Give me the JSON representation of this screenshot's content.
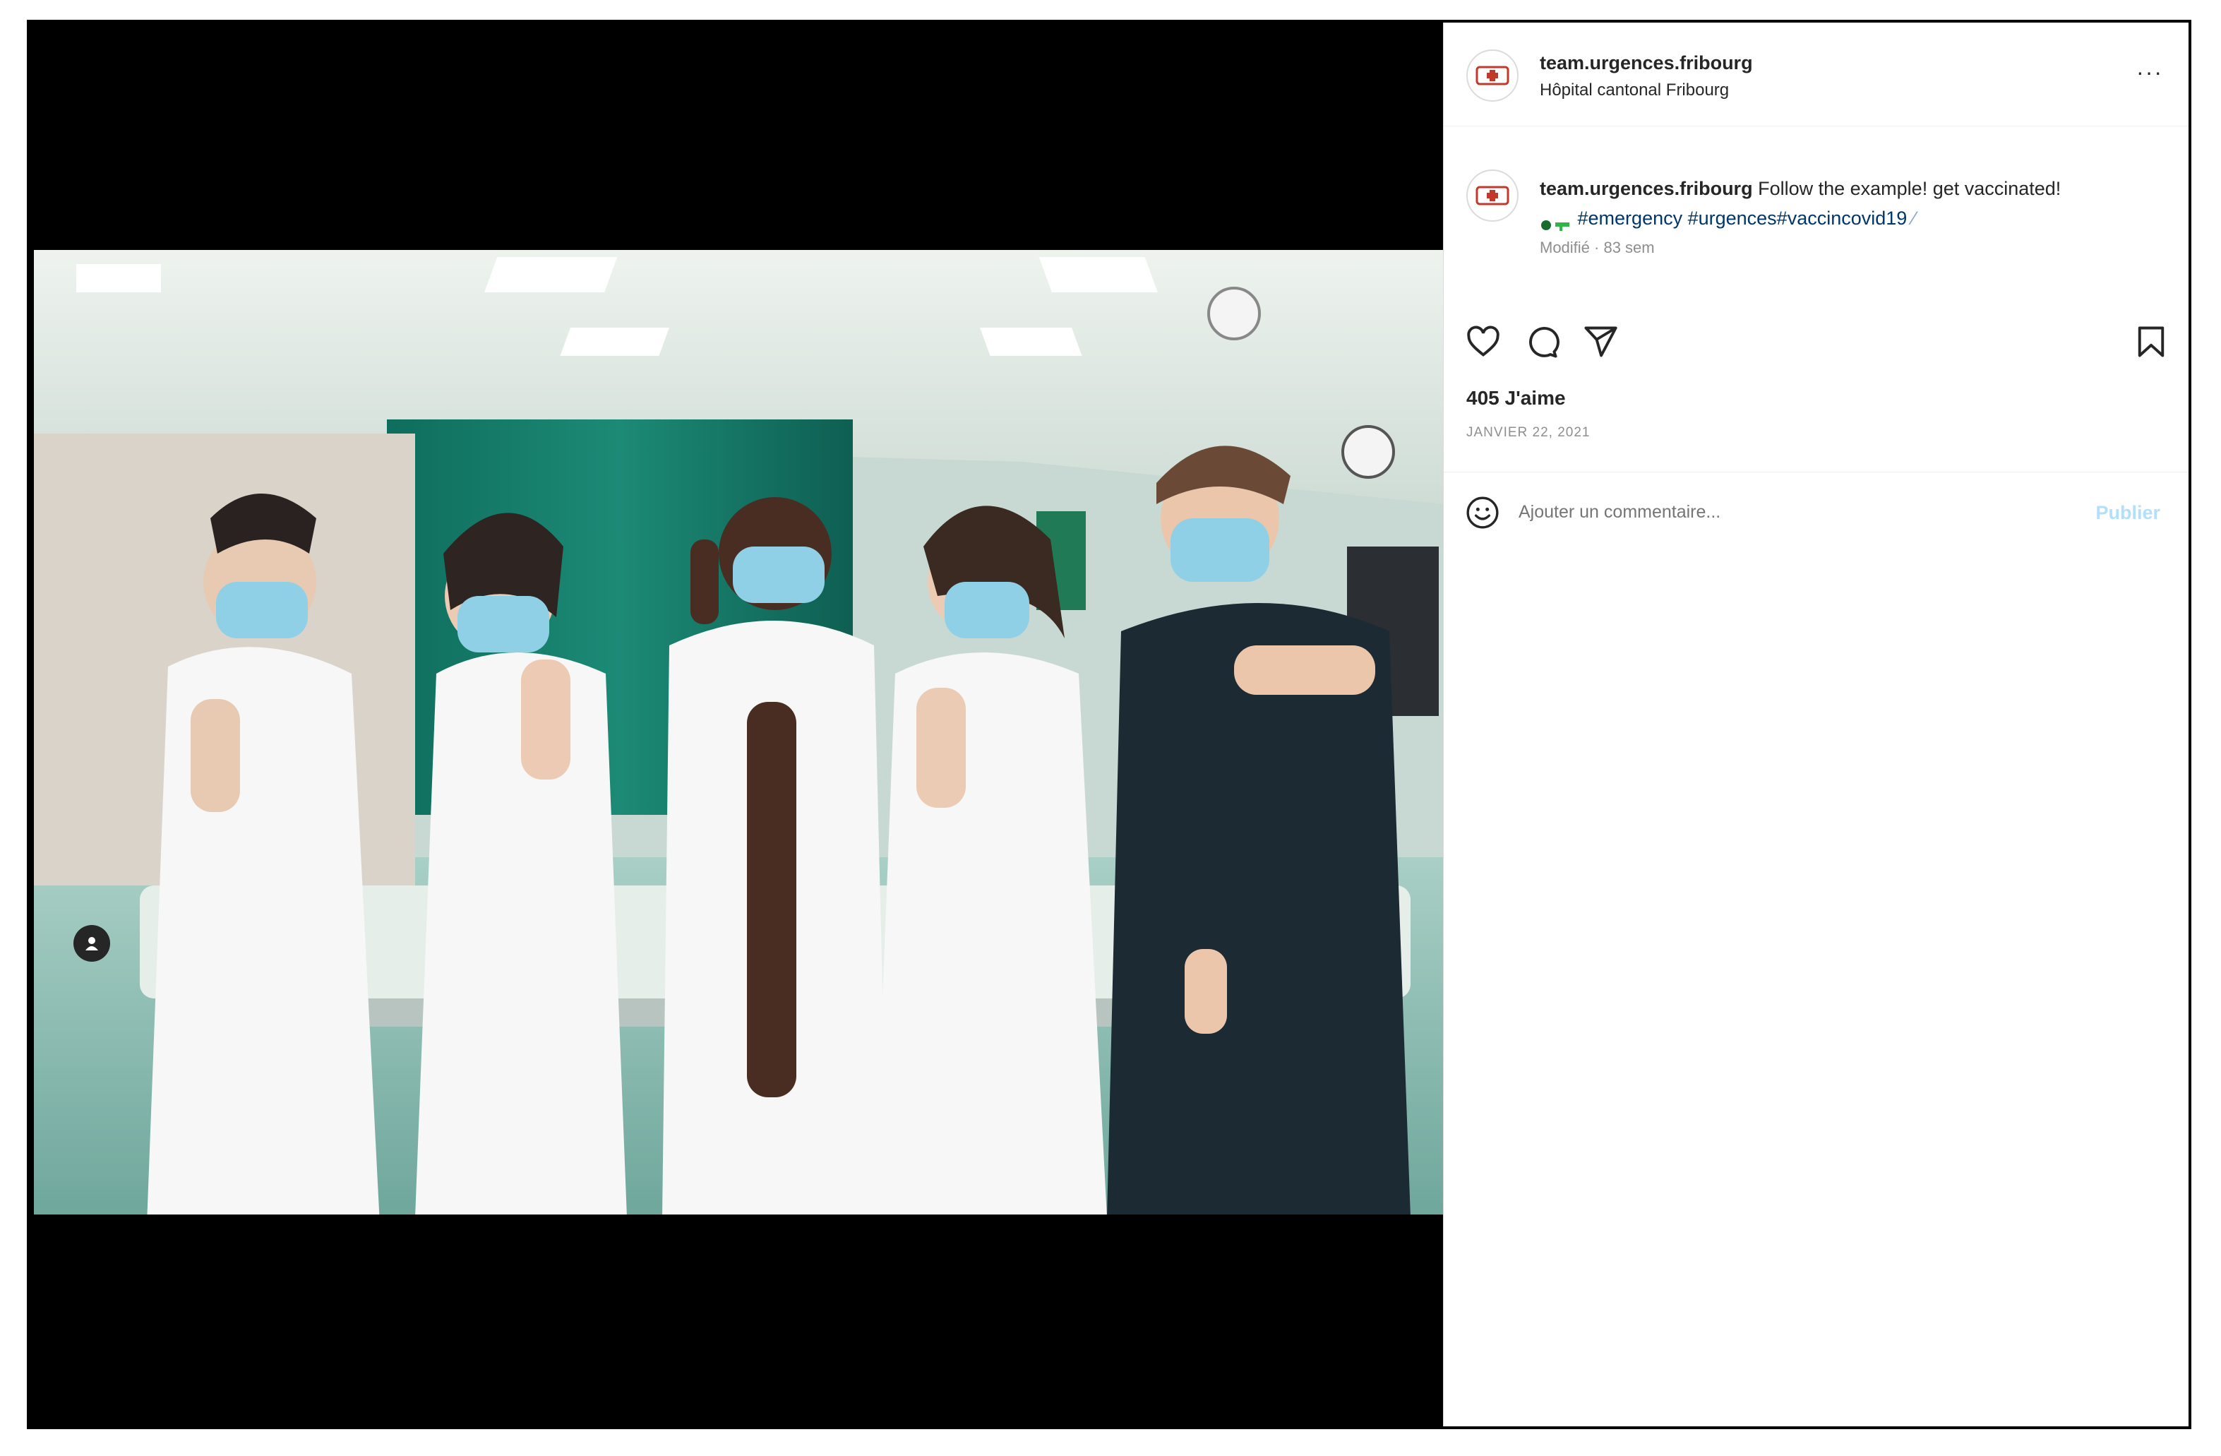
{
  "post": {
    "username": "team.urgences.fribourg",
    "location": "Hôpital cantonal Fribourg",
    "more_label": "···",
    "caption_text": "Follow the example! get vaccinated!",
    "hashtags": "#emergency #urgences#vaccincovid19",
    "meta": "Modifié · 83 sem",
    "likes": "405 J'aime",
    "date": "JANVIER 22, 2021"
  },
  "comment": {
    "placeholder": "Ajouter un commentaire...",
    "publish_label": "Publier"
  },
  "colors": {
    "link": "#00376b",
    "publish_disabled": "#b2dffc",
    "muted": "#8e8e8e"
  },
  "icons": [
    "heart-icon",
    "comment-icon",
    "share-icon",
    "bookmark-icon",
    "emoji-icon",
    "tag-user-icon",
    "more-icon"
  ]
}
